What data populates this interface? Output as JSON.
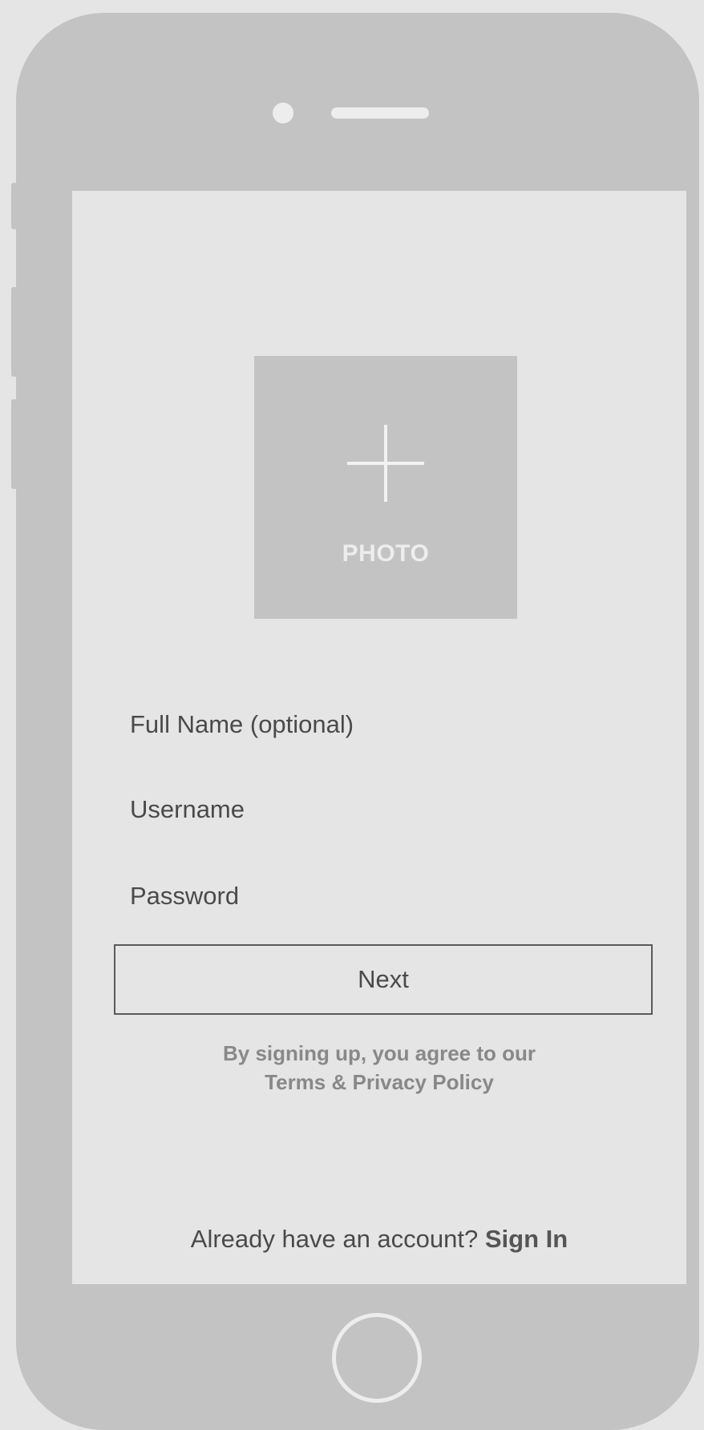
{
  "photo": {
    "label": "PHOTO",
    "icon": "plus-icon"
  },
  "form": {
    "full_name_placeholder": "Full Name (optional)",
    "username_placeholder": "Username",
    "password_placeholder": "Password",
    "next_label": "Next"
  },
  "terms": {
    "line1": "By signing up, you agree to our",
    "line2": "Terms & Privacy Policy"
  },
  "footer": {
    "prompt": "Already have an account?",
    "sign_in_label": "Sign In"
  },
  "colors": {
    "phone_body": "#c3c3c3",
    "screen_bg": "#e5e5e5",
    "text": "#4a4a4a",
    "muted_text": "#888888"
  }
}
